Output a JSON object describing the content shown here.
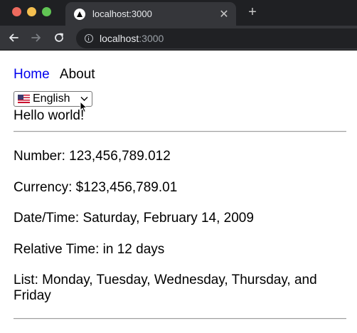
{
  "browser": {
    "tab_title": "localhost:3000",
    "new_tab_label": "+",
    "tab_close_label": "✕",
    "url_host": "localhost",
    "url_port": ":3000"
  },
  "page": {
    "nav": {
      "home": "Home",
      "about": "About"
    },
    "language_select": {
      "flag": "🇺🇸",
      "value": "English"
    },
    "hello": "Hello world!",
    "number": "Number: 123,456,789.012",
    "currency": "Currency: $123,456,789.01",
    "datetime": "Date/Time: Saturday, February 14, 2009",
    "relative_time": "Relative Time: in 12 days",
    "list": "List: Monday, Tuesday, Wednesday, Thursday, and Friday"
  }
}
